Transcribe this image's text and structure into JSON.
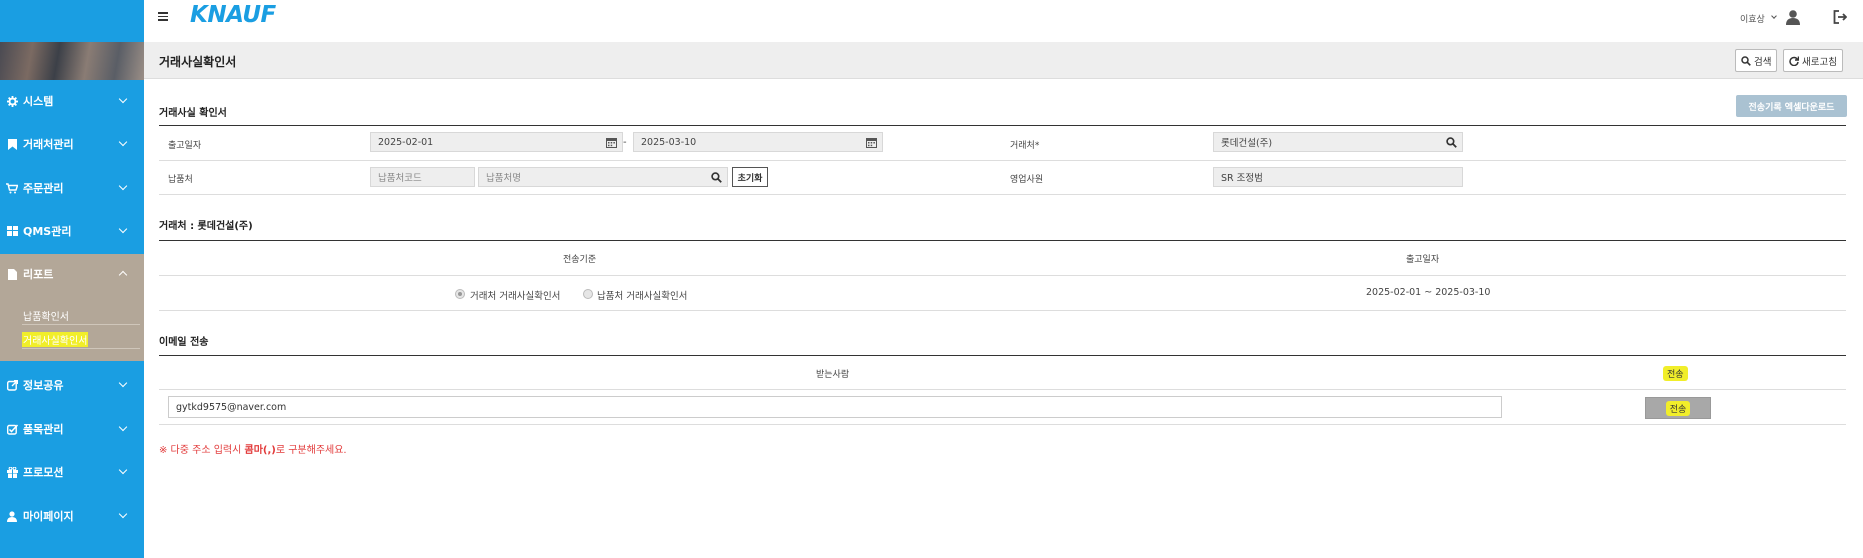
{
  "sidebar": {
    "items": [
      {
        "label": "시스템",
        "icon": "gear-icon"
      },
      {
        "label": "거래처관리",
        "icon": "bookmark-icon"
      },
      {
        "label": "주문관리",
        "icon": "cart-icon"
      },
      {
        "label": "QMS관리",
        "icon": "grid-icon"
      },
      {
        "label": "리포트",
        "icon": "document-icon"
      },
      {
        "label": "정보공유",
        "icon": "share-icon"
      },
      {
        "label": "품목관리",
        "icon": "checklist-icon"
      },
      {
        "label": "프로모션",
        "icon": "gift-icon"
      },
      {
        "label": "마이페이지",
        "icon": "user-icon"
      }
    ],
    "report_sub": [
      {
        "label": "납품확인서"
      },
      {
        "label": "거래사실확인서"
      }
    ]
  },
  "topbar": {
    "logo": "KNAUF",
    "user_name": "이효상"
  },
  "header": {
    "title": "거래사실확인서",
    "search_label": "검색",
    "refresh_label": "새로고침"
  },
  "search_form": {
    "section_title": "거래사실 확인서",
    "excel_button": "전송기록 엑셀다운로드",
    "ship_date_label": "출고일자",
    "date_from": "2025-02-01",
    "date_sep": "-",
    "date_to": "2025-03-10",
    "client_label": "거래처",
    "client_required": "*",
    "client_value": "롯데건설(주)",
    "delivery_label": "납품처",
    "delivery_code_placeholder": "납품처코드",
    "delivery_name_placeholder": "납품처명",
    "reset_button": "초기화",
    "sales_label": "영업사원",
    "sales_value": "SR 조정범"
  },
  "client_section": {
    "title": "거래처 : 롯데건설(주)",
    "col_basis": "전송기준",
    "col_date": "출고일자",
    "radio_client": "거래처 거래사실확인서",
    "radio_delivery": "납품처 거래사실확인서",
    "date_range": "2025-02-01 ~ 2025-03-10"
  },
  "email_section": {
    "title": "이메일 전송",
    "col_recipient": "받는사람",
    "col_send": "전송",
    "email_value": "gytkd9575@naver.com",
    "send_button": "전송",
    "note_prefix": "※ 다중 주소 입력시 ",
    "note_bold": "콤마(,)",
    "note_suffix": "로 구분해주세요."
  },
  "colors": {
    "sidebar_bg": "#1a9ee2",
    "report_bg": "#b3a798",
    "highlight": "#f1ee2a",
    "excel_btn": "#aac2d2",
    "note_red": "#e23a3a"
  }
}
